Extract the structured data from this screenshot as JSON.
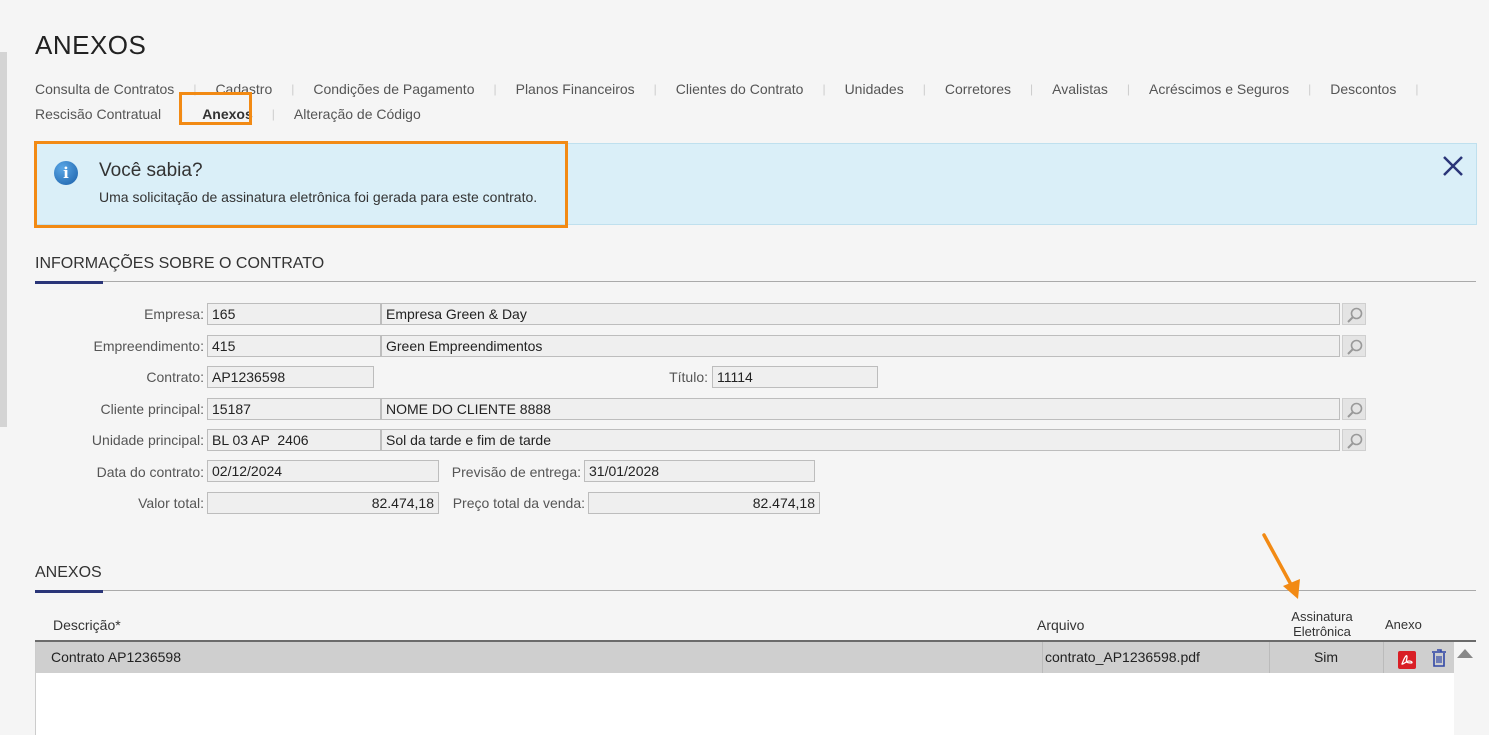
{
  "page": {
    "title": "ANEXOS"
  },
  "tabs": {
    "row1": [
      "Consulta de Contratos",
      "Cadastro",
      "Condições de Pagamento",
      "Planos Financeiros",
      "Clientes do Contrato",
      "Unidades",
      "Corretores",
      "Avalistas",
      "Acréscimos e Seguros",
      "Descontos"
    ],
    "row2": [
      "Rescisão Contratual",
      "Anexos",
      "Alteração de Código"
    ],
    "active": "Anexos"
  },
  "info": {
    "title": "Você sabia?",
    "text": "Uma solicitação de assinatura eletrônica foi gerada para este contrato."
  },
  "contract_section": {
    "title": "INFORMAÇÕES SOBRE O CONTRATO",
    "empresa": {
      "label": "Empresa:",
      "code": "165",
      "name": "Empresa Green & Day"
    },
    "empreendimento": {
      "label": "Empreendimento:",
      "code": "415",
      "name": "Green Empreendimentos"
    },
    "contrato": {
      "label": "Contrato:",
      "value": "AP1236598"
    },
    "titulo": {
      "label": "Título:",
      "value": "11114"
    },
    "cliente": {
      "label": "Cliente principal:",
      "code": "15187",
      "name": "NOME DO CLIENTE 8888"
    },
    "unidade": {
      "label": "Unidade principal:",
      "code": "BL 03 AP  2406",
      "name": "Sol da tarde e fim de tarde"
    },
    "data_contrato": {
      "label": "Data do contrato:",
      "value": "02/12/2024"
    },
    "previsao": {
      "label": "Previsão de entrega:",
      "value": "31/01/2028"
    },
    "valor_total": {
      "label": "Valor total:",
      "value": "82.474,18"
    },
    "preco_total": {
      "label": "Preço total da venda:",
      "value": "82.474,18"
    }
  },
  "attachments_section": {
    "title": "ANEXOS",
    "columns": {
      "descricao": "Descrição*",
      "arquivo": "Arquivo",
      "assinatura_line1": "Assinatura",
      "assinatura_line2": "Eletrônica",
      "anexo": "Anexo"
    },
    "rows": [
      {
        "descricao": "Contrato AP1236598",
        "arquivo": "contrato_AP1236598.pdf",
        "assinatura": "Sim"
      }
    ]
  },
  "colors": {
    "highlight": "#f28a14",
    "info_bg": "#daeff8",
    "accent": "#2a3578"
  },
  "icons": [
    "info-icon",
    "close-icon",
    "search-icon",
    "pdf-icon",
    "trash-icon",
    "scroll-up-icon",
    "arrow-annotation"
  ]
}
